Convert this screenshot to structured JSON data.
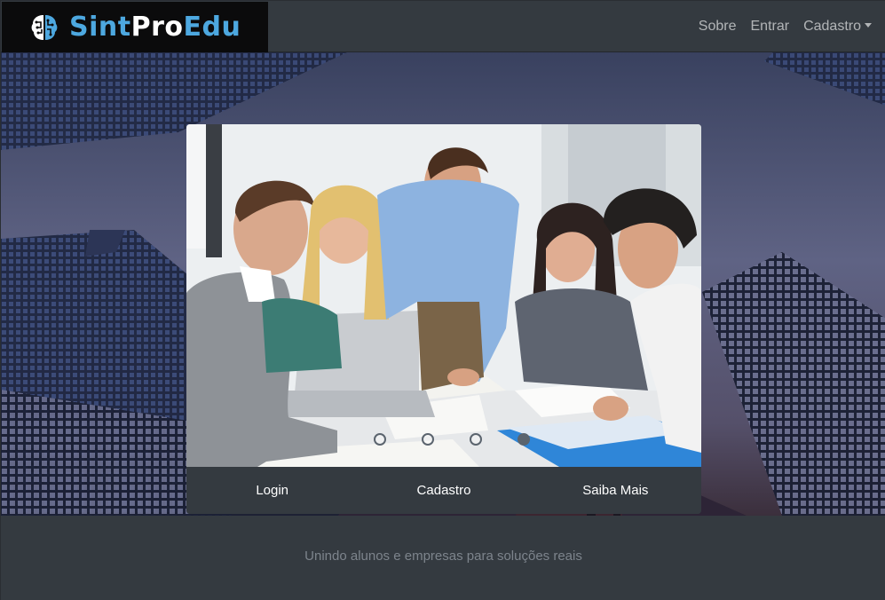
{
  "brand": {
    "part1": "Sint",
    "part2": "Pro",
    "part3": "Edu",
    "logo_icon": "brain-circuit-icon"
  },
  "nav": {
    "items": [
      {
        "label": "Sobre"
      },
      {
        "label": "Entrar"
      },
      {
        "label": "Cadastro",
        "dropdown": true
      }
    ]
  },
  "carousel": {
    "slide_count": 4,
    "active_index": 3,
    "image": "students-working-together-photo"
  },
  "actions": [
    {
      "label": "Login"
    },
    {
      "label": "Cadastro"
    },
    {
      "label": "Saiba Mais"
    }
  ],
  "footer": {
    "tagline": "Unindo alunos e empresas para soluções reais"
  },
  "colors": {
    "navbar": "#343a40",
    "brand_blue": "#4da8e0",
    "brand_bg": "#0b0b0c",
    "footer_text": "#7d848c"
  }
}
